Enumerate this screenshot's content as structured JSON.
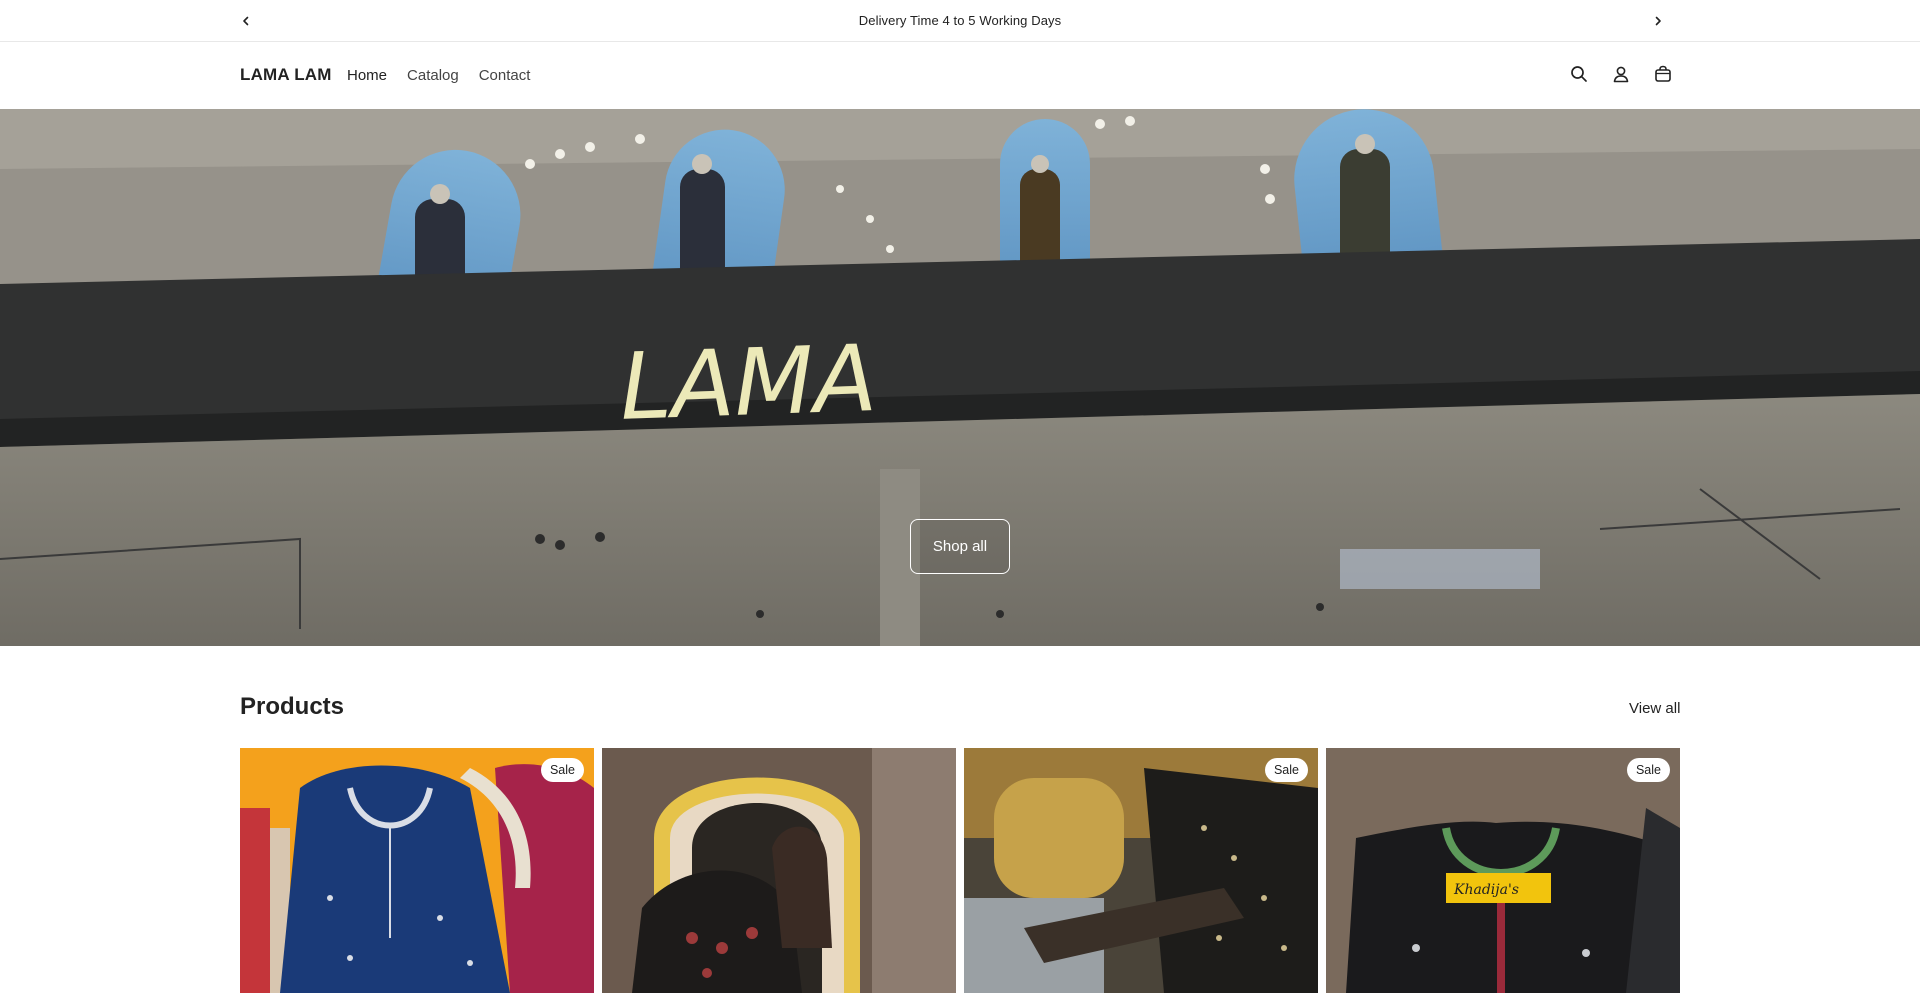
{
  "announcement": {
    "text": "Delivery Time 4 to 5 Working Days",
    "prev_icon": "chevron-left-icon",
    "next_icon": "chevron-right-icon"
  },
  "header": {
    "logo": "LAMA LAM",
    "nav": [
      {
        "label": "Home",
        "active": true
      },
      {
        "label": "Catalog",
        "active": false
      },
      {
        "label": "Contact",
        "active": false
      }
    ],
    "icons": [
      "search-icon",
      "account-icon",
      "cart-icon"
    ]
  },
  "hero": {
    "sign_text": "LAMA",
    "button_label": "Shop all"
  },
  "products": {
    "title": "Products",
    "view_all": "View all",
    "items": [
      {
        "badge": "Sale",
        "image": "navy-embroidered-kurta-photo"
      },
      {
        "badge": "",
        "image": "woman-with-black-dress-mirror-photo"
      },
      {
        "badge": "Sale",
        "image": "black-embroidered-suit-photo"
      },
      {
        "badge": "Sale",
        "image": "black-kurta-khadijas-label-photo",
        "label_text": "Khadija's"
      }
    ]
  },
  "colors": {
    "text": "#222222",
    "border": "#e8e8e8",
    "card1": "#f4a11c",
    "card2": "#6b5a4e",
    "card3": "#4a4439",
    "card4": "#7a6a5c"
  }
}
